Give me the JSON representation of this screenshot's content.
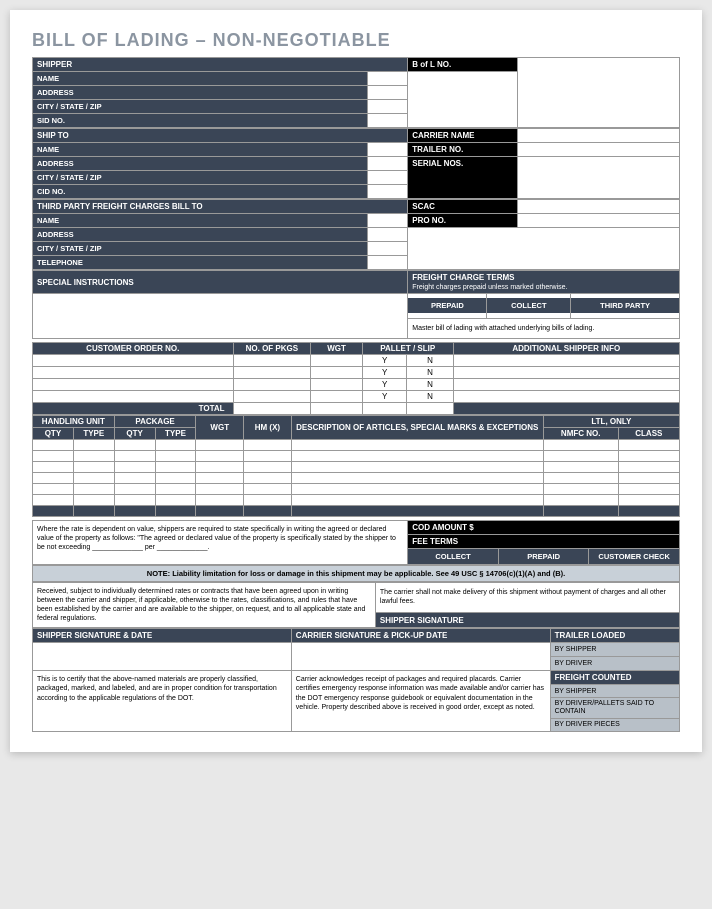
{
  "title": "BILL OF LADING – NON-NEGOTIABLE",
  "shipper": {
    "hdr": "SHIPPER",
    "name": "NAME",
    "address": "ADDRESS",
    "csz": "CITY / STATE / ZIP",
    "sid": "SID NO."
  },
  "bol": {
    "hdr": "B of L NO."
  },
  "shipto": {
    "hdr": "SHIP TO",
    "name": "NAME",
    "address": "ADDRESS",
    "csz": "CITY / STATE / ZIP",
    "cid": "CID NO."
  },
  "carrier": {
    "name": "CARRIER NAME",
    "trailer": "TRAILER NO.",
    "serial": "SERIAL NOS."
  },
  "third": {
    "hdr": "THIRD PARTY FREIGHT CHARGES BILL TO",
    "name": "NAME",
    "address": "ADDRESS",
    "csz": "CITY / STATE / ZIP",
    "tel": "TELEPHONE"
  },
  "scac": "SCAC",
  "pro": "PRO NO.",
  "si": "SPECIAL INSTRUCTIONS",
  "fct": {
    "hdr": "FREIGHT CHARGE TERMS",
    "sub": "Freight charges prepaid unless marked otherwise.",
    "prepaid": "PREPAID",
    "collect": "COLLECT",
    "tp": "THIRD PARTY",
    "master": "Master bill of lading with attached underlying bills of lading."
  },
  "orders": {
    "cust": "CUSTOMER ORDER NO.",
    "pkgs": "NO. OF PKGS",
    "wgt": "WGT",
    "pallet": "PALLET / SLIP",
    "addl": "ADDITIONAL SHIPPER INFO",
    "y": "Y",
    "n": "N",
    "total": "TOTAL"
  },
  "hu": {
    "hu": "HANDLING UNIT",
    "pkg": "PACKAGE",
    "ltl": "LTL, ONLY",
    "qty": "QTY",
    "type": "TYPE",
    "wgt": "WGT",
    "hm": "HM (X)",
    "desc": "DESCRIPTION OF ARTICLES, SPECIAL MARKS & EXCEPTIONS",
    "nmfc": "NMFC NO.",
    "class": "CLASS"
  },
  "rate": "Where the rate is dependent on value, shippers are required to state specifically in writing the agreed or declared value of the property as follows: \"The agreed or declared value of the property is specifically stated by the shipper to be not exceeding _____________ per _____________.",
  "cod": "COD AMOUNT $",
  "fee": "FEE TERMS",
  "collect": "COLLECT",
  "prepaid": "PREPAID",
  "cc": "CUSTOMER CHECK",
  "note": "NOTE: Liability limitation for loss or damage in this shipment may be applicable. See 49 USC § 14706(c)(1)(A) and (B).",
  "received": "Received, subject to individually determined rates or contracts that have been agreed upon in writing between the carrier and shipper, if applicable, otherwise to the rates, classifications, and rules that have been established by the carrier and are available to the shipper, on request, and to all applicable state and federal regulations.",
  "nodeliver": "The carrier shall not make delivery of this shipment without payment of charges and all other lawful fees.",
  "shipsig": "SHIPPER SIGNATURE",
  "ssd": "SHIPPER SIGNATURE & DATE",
  "cspd": "CARRIER SIGNATURE & PICK-UP DATE",
  "tl": {
    "hdr": "TRAILER LOADED",
    "bs": "BY SHIPPER",
    "bd": "BY DRIVER"
  },
  "fc": {
    "hdr": "FREIGHT COUNTED",
    "bs": "BY SHIPPER",
    "bdp": "BY DRIVER/PALLETS SAID TO CONTAIN",
    "bdpc": "BY DRIVER PIECES"
  },
  "certify": "This is to certify that the above-named materials are properly classified, packaged, marked, and labeled, and are in proper condition for transportation according to the applicable regulations of the DOT.",
  "ack": "Carrier acknowledges receipt of packages and required placards. Carrier certifies emergency response information was made available and/or carrier has the DOT emergency response guidebook or equivalent documentation in the vehicle. Property described above is received in good order, except as noted."
}
